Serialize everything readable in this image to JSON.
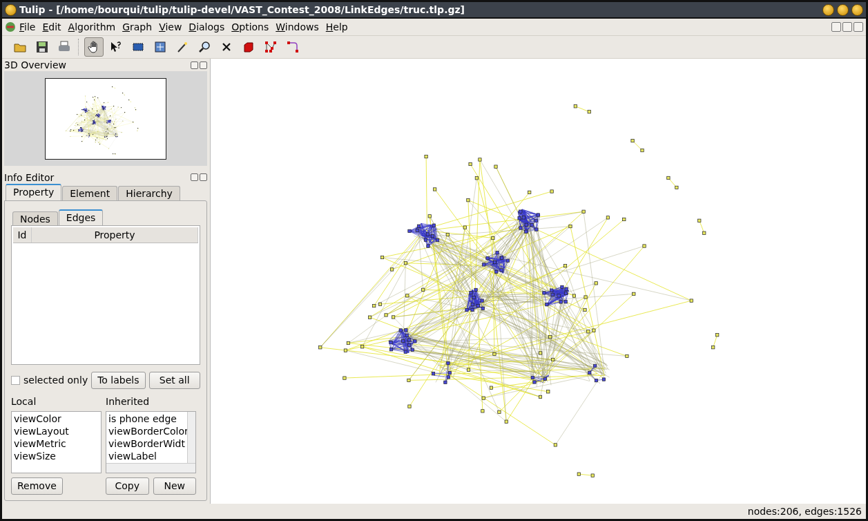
{
  "window": {
    "title": "Tulip - [/home/bourqui/tulip/tulip-devel/VAST_Contest_2008/LinkEdges/truc.tlp.gz]"
  },
  "menu": [
    "File",
    "Edit",
    "Algorithm",
    "Graph",
    "View",
    "Dialogs",
    "Options",
    "Windows",
    "Help"
  ],
  "toolbar": [
    {
      "kind": "open",
      "selected": false
    },
    {
      "kind": "save",
      "selected": false
    },
    {
      "kind": "print",
      "selected": false
    },
    {
      "kind": "hand",
      "selected": true
    },
    {
      "kind": "whatsthis",
      "selected": false
    },
    {
      "kind": "select",
      "selected": false
    },
    {
      "kind": "selectmove",
      "selected": false
    },
    {
      "kind": "wand",
      "selected": false
    },
    {
      "kind": "zoom",
      "selected": false
    },
    {
      "kind": "delete",
      "selected": false
    },
    {
      "kind": "cube",
      "selected": false
    },
    {
      "kind": "nodes",
      "selected": false
    },
    {
      "kind": "bend",
      "selected": false
    }
  ],
  "overview": {
    "title": "3D Overview"
  },
  "info_editor": {
    "title": "Info Editor",
    "tabs": [
      {
        "label": "Property",
        "selected": true
      },
      {
        "label": "Element",
        "selected": false
      },
      {
        "label": "Hierarchy",
        "selected": false
      }
    ],
    "subtabs": [
      {
        "label": "Nodes",
        "selected": false
      },
      {
        "label": "Edges",
        "selected": true
      }
    ],
    "columns": [
      "Id",
      "Property"
    ],
    "selected_only": {
      "label": "selected only",
      "checked": false
    },
    "buttons": [
      "To labels",
      "Set all"
    ],
    "local": {
      "label": "Local",
      "items": [
        "viewColor",
        "viewLayout",
        "viewMetric",
        "viewSize"
      ]
    },
    "inherited": {
      "label": "Inherited",
      "items": [
        "is phone edge",
        "viewBorderColor",
        "viewBorderWidt",
        "viewLabel"
      ]
    },
    "local_buttons": [
      "Remove"
    ],
    "inherited_buttons": [
      "Copy",
      "New"
    ]
  },
  "status_bar": "nodes:206, edges:1526"
}
